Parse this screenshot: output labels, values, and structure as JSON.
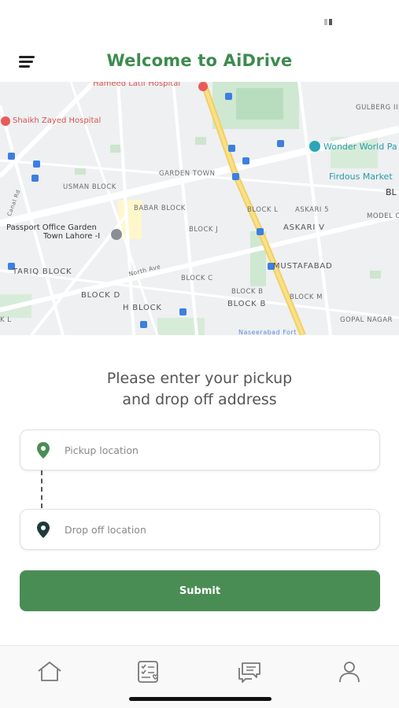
{
  "header": {
    "title": "Welcome to AiDrive",
    "menu_icon": "hamburger-menu-icon"
  },
  "map": {
    "labels": {
      "hameed": "Hameed Latif Hospital",
      "shaikh": "Shaikh Zayed Hospital",
      "gulberg": "GULBERG III",
      "wonder": "Wonder World Pa",
      "firdous": "Firdous Market",
      "bl": "BL",
      "garden": "GARDEN TOWN",
      "usman": "USMAN BLOCK",
      "babar": "BABAR BLOCK",
      "blockl": "BLOCK L",
      "askari5": "ASKARI 5",
      "model": "MODEL C",
      "passport": "Passport Office Garden",
      "passport2": "Town Lahore -I",
      "blockj": "BLOCK J",
      "askariv": "ASKARI V",
      "tariq": "TARIQ BLOCK",
      "northave": "North Ave",
      "mustafabad": "MUSTAFABAD",
      "blockc": "BLOCK C",
      "blockd": "BLOCK D",
      "hblock": "H BLOCK",
      "blockb1": "BLOCK B",
      "blockb2": "BLOCK B",
      "blockm": "BLOCK M",
      "gopal": "GOPAL NAGAR",
      "kl": "K L",
      "canal": "Canal Rd",
      "nabi": "Naseerabad Fort"
    }
  },
  "prompt": {
    "line1": "Please enter your pickup",
    "line2": "and drop off address"
  },
  "form": {
    "pickup_placeholder": "Pickup location",
    "dropoff_placeholder": "Drop off location",
    "submit_label": "Submit"
  },
  "colors": {
    "accent": "#4a8d54",
    "title": "#3d8b4f",
    "pickup_pin": "#4a8d54",
    "dropoff_pin": "#1f3b3b"
  },
  "tabbar": {
    "icons": [
      "home-icon",
      "checklist-icon",
      "chat-icon",
      "profile-icon"
    ]
  }
}
